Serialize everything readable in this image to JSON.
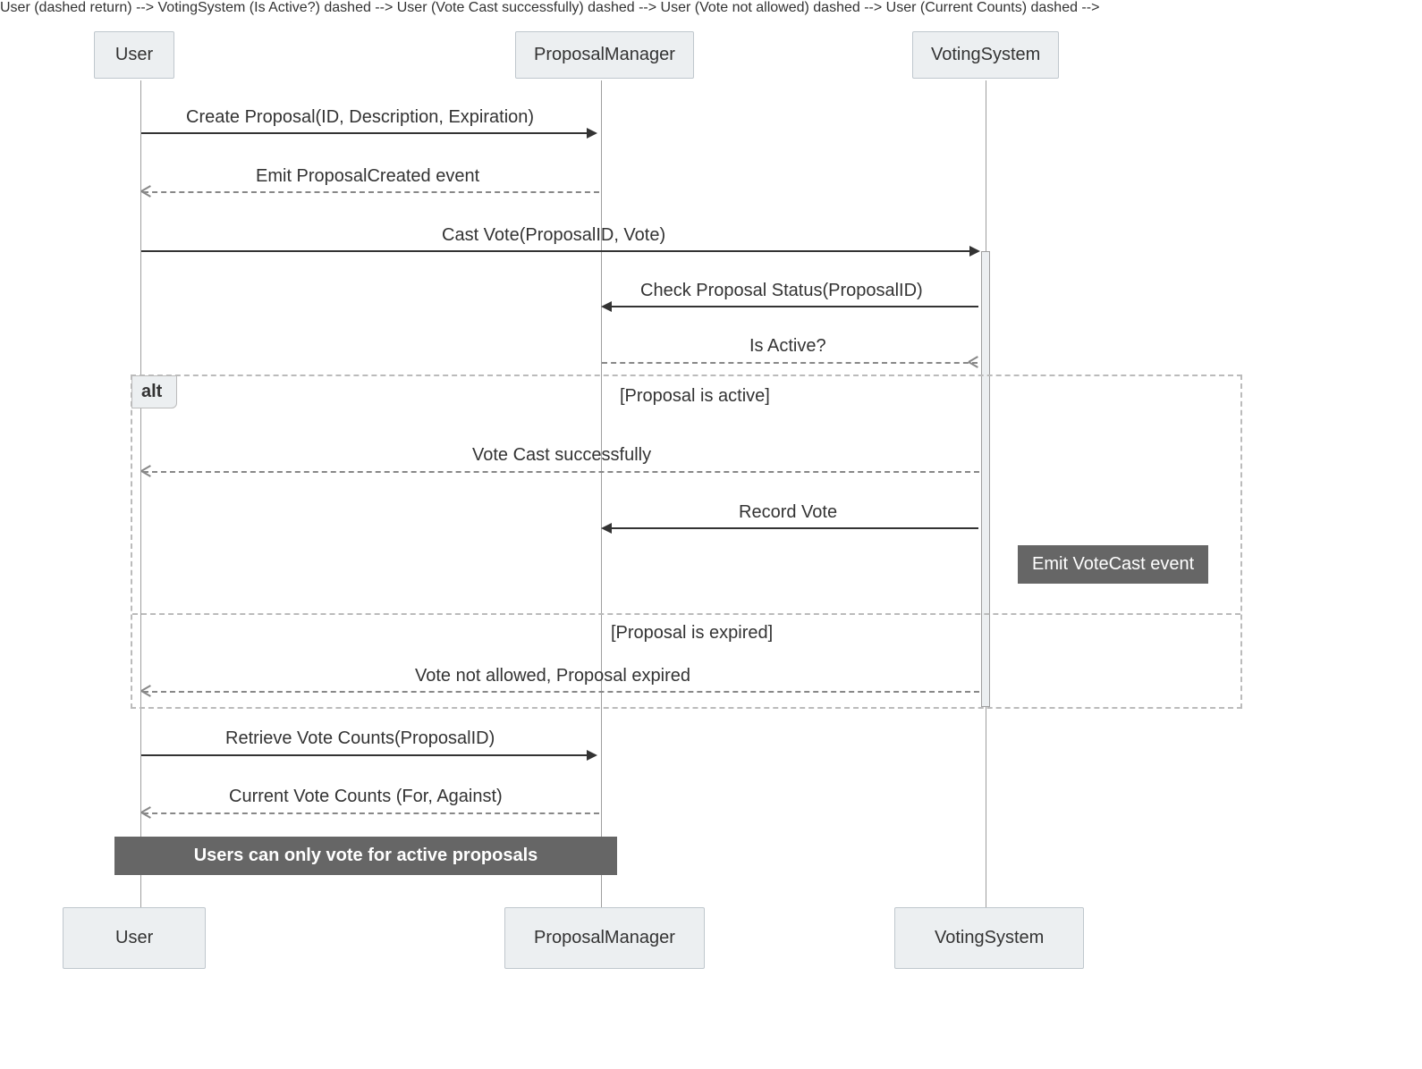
{
  "participants": {
    "user": "User",
    "proposalManager": "ProposalManager",
    "votingSystem": "VotingSystem"
  },
  "messages": {
    "m1": "Create Proposal(ID, Description, Expiration)",
    "m2": "Emit ProposalCreated event",
    "m3": "Cast Vote(ProposalID, Vote)",
    "m4": "Check Proposal Status(ProposalID)",
    "m5": "Is Active?",
    "m6": "Vote Cast successfully",
    "m7": "Record Vote",
    "m8": "Vote not allowed, Proposal expired",
    "m9": "Retrieve Vote Counts(ProposalID)",
    "m10": "Current Vote Counts (For, Against)"
  },
  "alt": {
    "label": "alt",
    "cond1": "[Proposal is active]",
    "cond2": "[Proposal is expired]"
  },
  "notes": {
    "voteCast": "Emit VoteCast event",
    "footer": "Users can only vote for active proposals"
  }
}
